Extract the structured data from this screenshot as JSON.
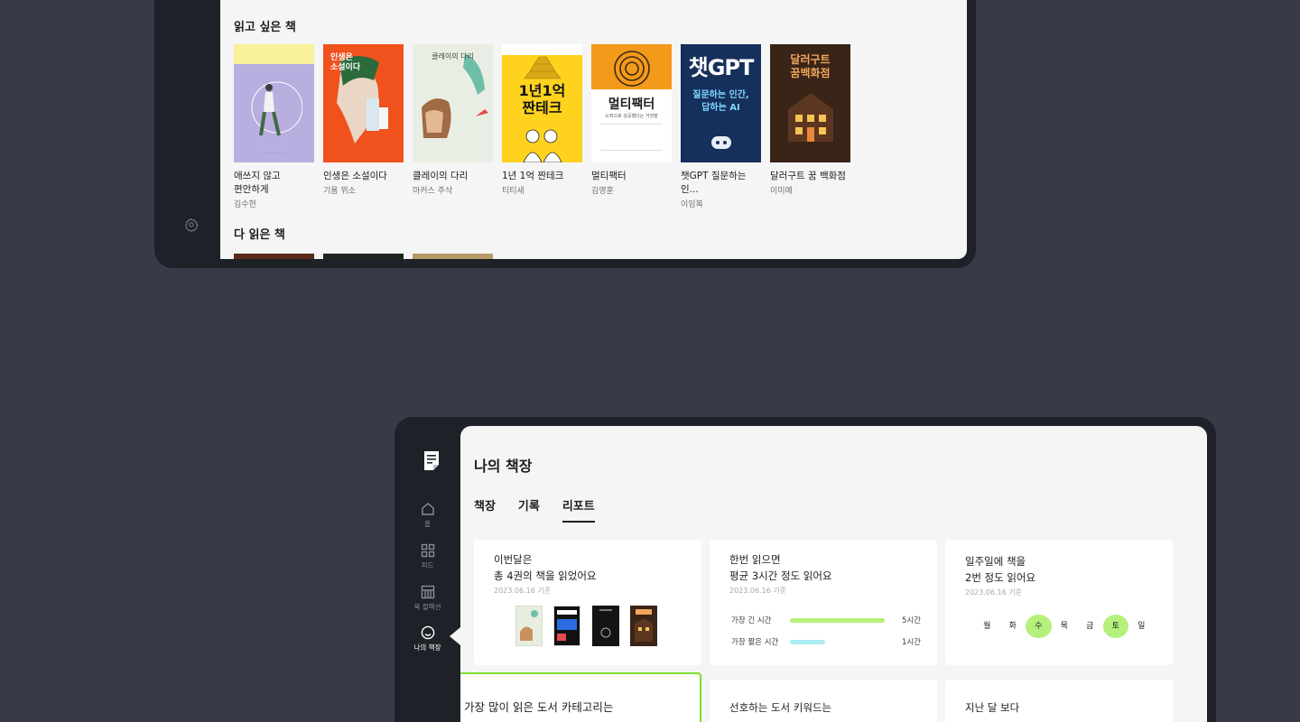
{
  "top": {
    "want_title": "읽고 싶은 책",
    "done_title": "다 읽은 책",
    "books": [
      {
        "title_line1": "애쓰지 않고",
        "title_line2": "편안하게",
        "author": "김수현",
        "cover_color": "#b9aee0",
        "cover_text": "애쓰지 않고 편안하게"
      },
      {
        "title_line1": "인생은 소설이다",
        "title_line2": "",
        "author": "기욤 뮈소",
        "cover_color": "#f0521e",
        "cover_text": "인생은 소설이다"
      },
      {
        "title_line1": "클레이의 다리",
        "title_line2": "",
        "author": "마커스 주삭",
        "cover_color": "#e9eee4",
        "cover_text": "클레이의 다리"
      },
      {
        "title_line1": "1년 1억 짠테크",
        "title_line2": "",
        "author": "티티새",
        "cover_color": "#ffd21e",
        "cover_text": "1년1억 짠테크"
      },
      {
        "title_line1": "멀티팩터",
        "title_line2": "",
        "author": "김영훈",
        "cover_color": "#f39a1a",
        "cover_text": "멀티팩터"
      },
      {
        "title_line1": "챗GPT 질문하는 인...",
        "title_line2": "",
        "author": "이임복",
        "cover_color": "#16305c",
        "cover_text": "챗GPT"
      },
      {
        "title_line1": "달러구트 꿈 백화점",
        "title_line2": "",
        "author": "이미예",
        "cover_color": "#3a2418",
        "cover_text": "달러구트 꿈백화점"
      }
    ]
  },
  "app": {
    "page_title": "나의 책장",
    "tabs": [
      "책장",
      "기록",
      "리포트"
    ],
    "active_tab": "리포트",
    "nav": [
      {
        "label": "홈",
        "icon": "home-icon"
      },
      {
        "label": "피드",
        "icon": "grid-icon"
      },
      {
        "label": "북 컬렉션",
        "icon": "collection-icon"
      },
      {
        "label": "나의 책장",
        "icon": "smile-icon"
      }
    ],
    "cards": {
      "monthly": {
        "line1": "이번달은",
        "line2": "총 4권의 책을 읽었어요",
        "date": "2023.06.16 기준"
      },
      "time": {
        "line1": "한번 읽으면",
        "line2": "평균 3시간 정도 읽어요",
        "date": "2023.06.16 기준",
        "longest_label": "가장 긴 시간",
        "longest_value": "5시간",
        "longest_ratio": 1.0,
        "shortest_label": "가장 짧은 시간",
        "shortest_value": "1시간",
        "shortest_ratio": 0.37,
        "long_color": "#b6f07c",
        "short_color": "#a8eef3"
      },
      "weekly": {
        "line1": "일주일에 책을",
        "line2": "2번 정도 읽어요",
        "date": "2023.06.16 기준",
        "days": [
          "월",
          "화",
          "수",
          "목",
          "금",
          "토",
          "일"
        ],
        "active_days": [
          2,
          5
        ]
      },
      "category": {
        "line1": "가장 많이 읽은 도서 카테고리는"
      },
      "keyword": {
        "line1": "선호하는 도서 키워드는"
      },
      "compare": {
        "line1": "지난 달 보다"
      }
    }
  }
}
